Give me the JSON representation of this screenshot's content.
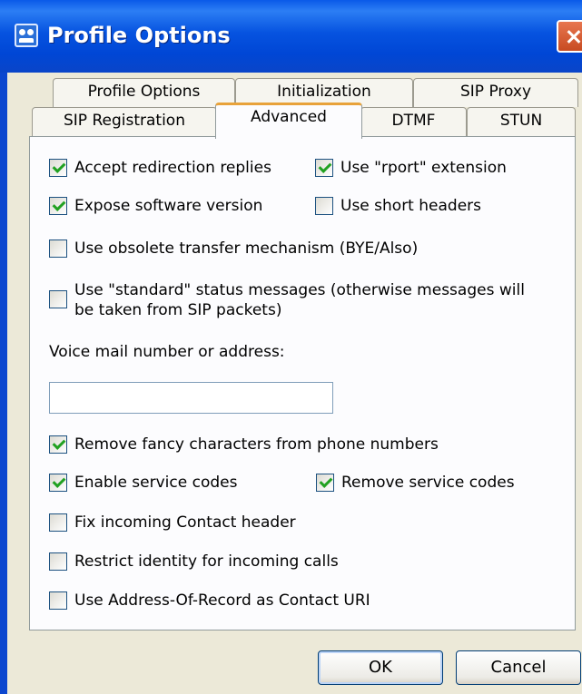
{
  "window": {
    "title": "Profile Options",
    "app_icon": "profile-icon",
    "close_icon": "close-icon"
  },
  "tabs": {
    "row1": [
      "Profile Options",
      "Initialization",
      "SIP Proxy"
    ],
    "row2": [
      "SIP Registration",
      "Advanced",
      "DTMF",
      "STUN"
    ],
    "active": "Advanced"
  },
  "options": {
    "accept_redirection": {
      "label": "Accept redirection replies",
      "checked": true
    },
    "use_rport": {
      "label": "Use \"rport\" extension",
      "checked": true
    },
    "expose_version": {
      "label": "Expose software version",
      "checked": true
    },
    "short_headers": {
      "label": "Use short headers",
      "checked": false
    },
    "obsolete_transfer": {
      "label": "Use obsolete transfer mechanism (BYE/Also)",
      "checked": false
    },
    "standard_status_line1": "Use \"standard\" status messages (otherwise messages will",
    "standard_status_line2": "be taken from SIP packets)",
    "standard_status_checked": false,
    "voicemail_label": "Voice mail number or address:",
    "voicemail_value": "",
    "remove_fancy": {
      "label": "Remove fancy characters from phone numbers",
      "checked": true
    },
    "enable_service_codes": {
      "label": "Enable service codes",
      "checked": true
    },
    "remove_service_codes": {
      "label": "Remove service codes",
      "checked": true
    },
    "fix_contact": {
      "label": "Fix incoming Contact header",
      "checked": false
    },
    "restrict_identity": {
      "label": "Restrict identity for incoming calls",
      "checked": false
    },
    "aor_contact": {
      "label": "Use Address-Of-Record as Contact URI",
      "checked": false
    }
  },
  "buttons": {
    "ok": "OK",
    "cancel": "Cancel"
  }
}
